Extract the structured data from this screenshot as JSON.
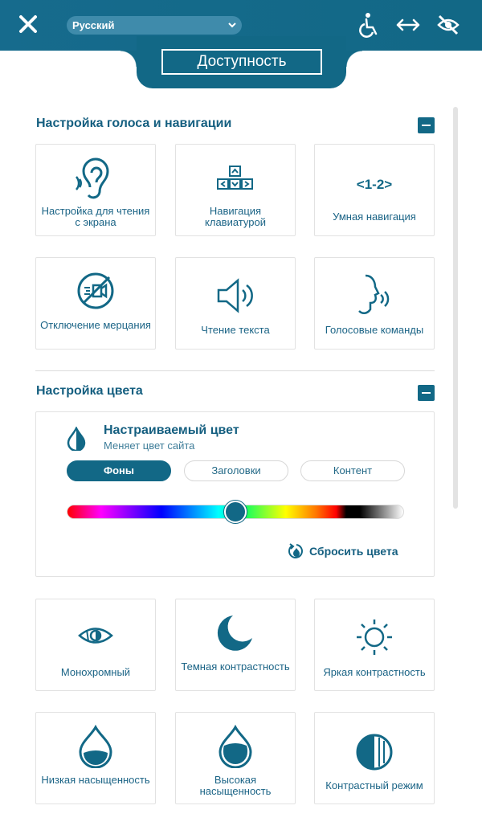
{
  "header": {
    "language": "Русский",
    "title": "Доступность"
  },
  "sections": {
    "voice_nav": {
      "title": "Настройка голоса и навигации",
      "tiles": [
        "Настройка для чтения с экрана",
        "Навигация клавиатурой",
        "Умная навигация",
        "Отключение мерцания",
        "Чтение текста",
        "Голосовые команды"
      ],
      "smart_nav_glyph": "<1-2>"
    },
    "color": {
      "title": "Настройка цвета",
      "custom_color": {
        "title": "Настраиваемый цвет",
        "subtitle": "Меняет цвет сайта",
        "tabs": [
          "Фоны",
          "Заголовки",
          "Контент"
        ],
        "active_tab": "Фоны",
        "reset_label": "Сбросить цвета",
        "slider_value_fraction": 0.5
      },
      "tiles": [
        "Монохромный",
        "Темная контрастность",
        "Яркая контрастность",
        "Низкая насыщенность",
        "Высокая насыщенность",
        "Контрастный режим"
      ]
    }
  },
  "colors": {
    "primary": "#126886",
    "text": "#1b6486",
    "border": "#e2e2e2"
  },
  "icons": {
    "close": "close-icon",
    "accessibility": "wheelchair-icon",
    "width": "arrows-horizontal-icon",
    "hide": "eye-off-icon"
  }
}
